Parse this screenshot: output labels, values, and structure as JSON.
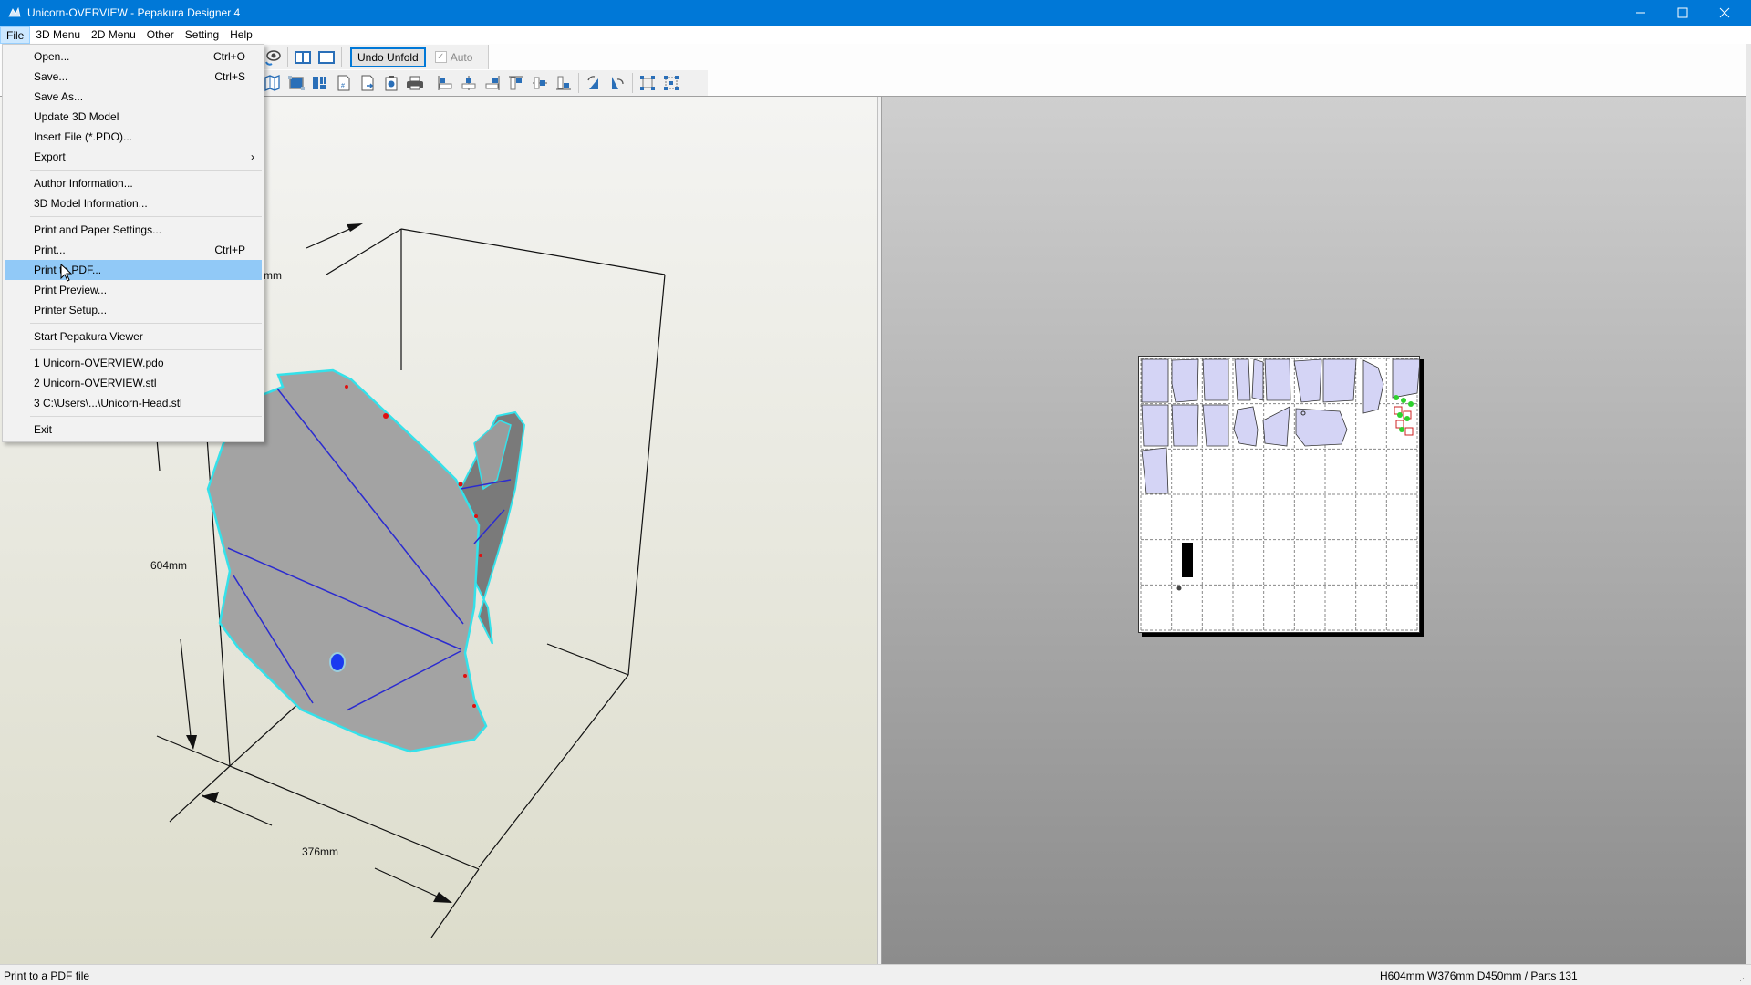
{
  "window": {
    "title": "Unicorn-OVERVIEW - Pepakura Designer 4",
    "app_icon": "pepakura-app-icon",
    "controls": {
      "minimize": "—",
      "maximize": "☐",
      "close": "✕"
    }
  },
  "menubar": {
    "items": [
      {
        "label": "File",
        "active": true
      },
      {
        "label": "3D Menu"
      },
      {
        "label": "2D Menu"
      },
      {
        "label": "Other"
      },
      {
        "label": "Setting"
      },
      {
        "label": "Help"
      }
    ]
  },
  "file_menu": {
    "groups": [
      [
        {
          "label": "Open...",
          "shortcut": "Ctrl+O"
        },
        {
          "label": "Save...",
          "shortcut": "Ctrl+S"
        },
        {
          "label": "Save As..."
        },
        {
          "label": "Update 3D Model"
        },
        {
          "label": "Insert File (*.PDO)..."
        },
        {
          "label": "Export",
          "submenu": true,
          "arrow": "›"
        }
      ],
      [
        {
          "label": "Author Information..."
        },
        {
          "label": "3D Model Information..."
        }
      ],
      [
        {
          "label": "Print and Paper Settings..."
        },
        {
          "label": "Print...",
          "shortcut": "Ctrl+P"
        },
        {
          "label": "Print to PDF...",
          "highlighted": true
        },
        {
          "label": "Print Preview..."
        },
        {
          "label": "Printer Setup..."
        }
      ],
      [
        {
          "label": "Start Pepakura Viewer"
        }
      ],
      [
        {
          "label": "1 Unicorn-OVERVIEW.pdo"
        },
        {
          "label": "2 Unicorn-OVERVIEW.stl"
        },
        {
          "label": "3 C:\\Users\\...\\Unicorn-Head.stl"
        }
      ],
      [
        {
          "label": "Exit"
        }
      ]
    ]
  },
  "toolbar": {
    "row1_icons": [
      "view-rotate-icon",
      "split-view-icon",
      "single-view-icon"
    ],
    "undo_unfold_label": "Undo Unfold",
    "auto_label": "Auto",
    "auto_checked": true,
    "row2_icons": [
      "unfold-icon",
      "select-all-parts-icon",
      "arrange-parts-icon",
      "page-number-icon",
      "export-page-icon",
      "clipboard-icon",
      "print-icon",
      "align-left-icon",
      "align-center-icon",
      "align-right-icon",
      "align-top-icon",
      "align-middle-icon",
      "align-bottom-icon",
      "rotate-left-icon",
      "rotate-right-icon",
      "fit-selection-icon",
      "fit-all-icon"
    ]
  },
  "view3d": {
    "dimensions": {
      "height_label": "604mm",
      "width_label": "376mm",
      "depth_label_visible": "mm"
    },
    "colors": {
      "background_top": "#f4f4f2",
      "background_bottom": "#dcdccb",
      "model": "#a3a3a3",
      "edge": "#34e1ea",
      "fold": "#2b2bd0",
      "cut": "#e01010"
    }
  },
  "view2d": {
    "paper": {
      "columns": 9,
      "rows": 6
    },
    "colors": {
      "part_fill": "#d4d4f5",
      "part_stroke": "#333333",
      "tab_green": "#2ed12e",
      "tab_red": "#cc2020"
    }
  },
  "statusbar": {
    "message": "Print to a PDF file",
    "info": "H604mm W376mm D450mm / Parts 131"
  }
}
